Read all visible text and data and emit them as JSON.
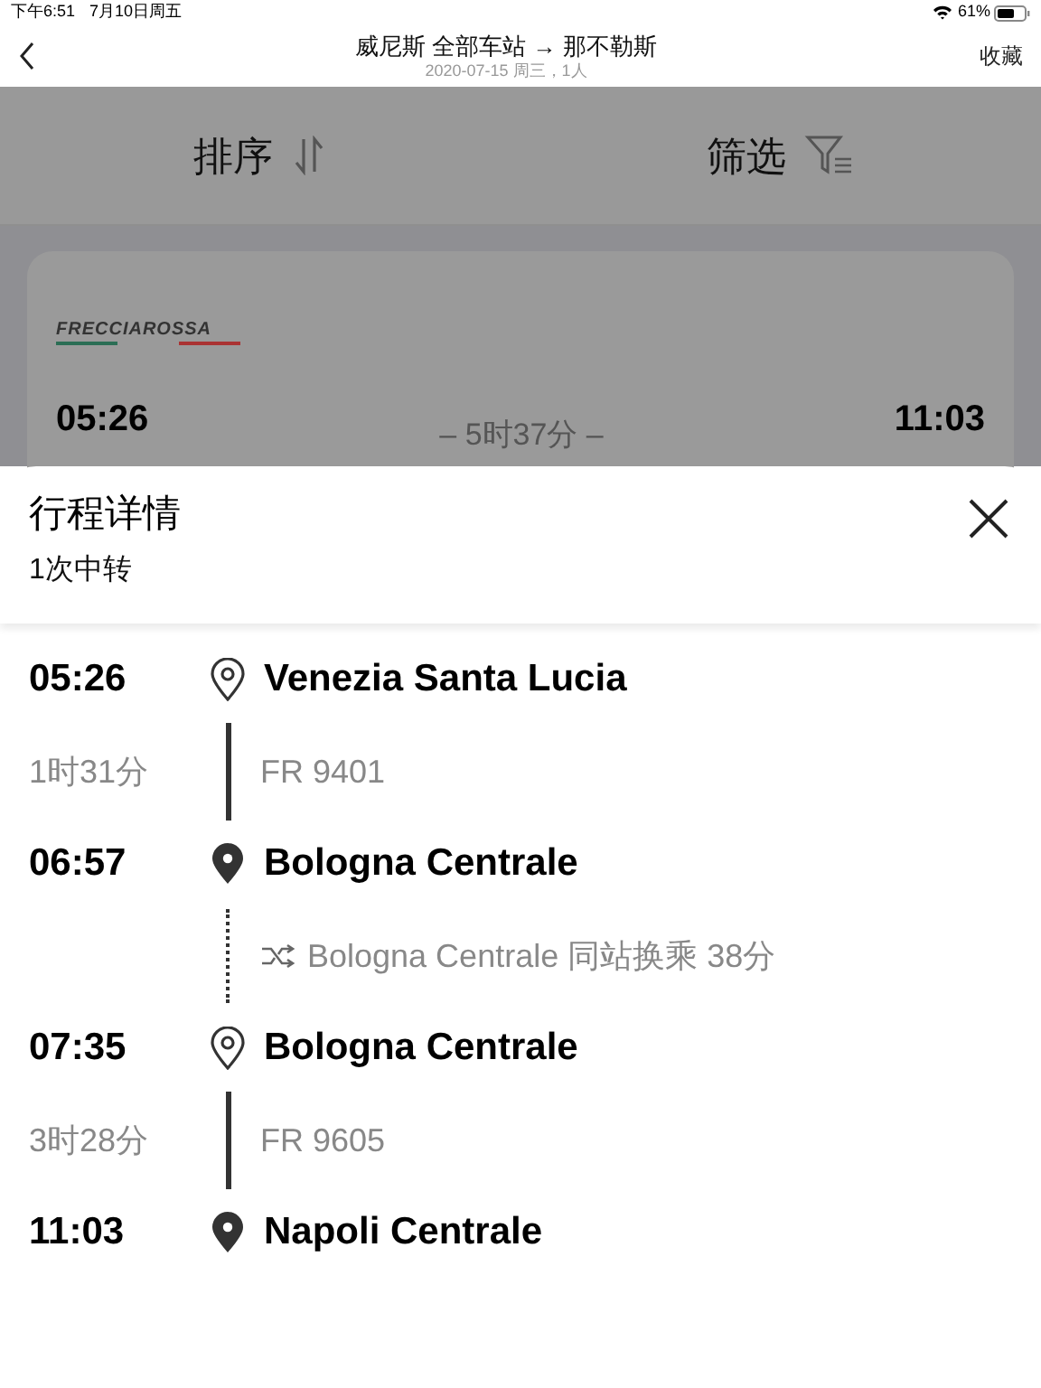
{
  "status_bar": {
    "time": "下午6:51",
    "date": "7月10日周五",
    "battery": "61%"
  },
  "nav": {
    "title": "威尼斯 全部车站 → 那不勒斯",
    "subtitle": "2020-07-15 周三，1人",
    "action": "收藏"
  },
  "toolbar": [
    {
      "label": "排序",
      "kind": "sort"
    },
    {
      "label": "筛选",
      "kind": "filter"
    }
  ],
  "result_card": {
    "logo": "FRECCIAROSSA",
    "depart": "05:26",
    "duration": "– 5时37分 –",
    "arrive": "11:03"
  },
  "sheet": {
    "title": "行程详情",
    "subtitle": "1次中转"
  },
  "timeline": [
    {
      "kind": "stop",
      "time": "05:26",
      "station": "Venezia Santa Lucia",
      "filled": false
    },
    {
      "kind": "segment",
      "duration": "1时31分",
      "train": "FR 9401"
    },
    {
      "kind": "stop",
      "time": "06:57",
      "station": "Bologna Centrale",
      "filled": true
    },
    {
      "kind": "transfer",
      "text": "Bologna Centrale 同站换乘 38分"
    },
    {
      "kind": "stop",
      "time": "07:35",
      "station": "Bologna Centrale",
      "filled": false
    },
    {
      "kind": "segment",
      "duration": "3时28分",
      "train": "FR 9605"
    },
    {
      "kind": "stop",
      "time": "11:03",
      "station": "Napoli Centrale",
      "filled": true
    }
  ]
}
